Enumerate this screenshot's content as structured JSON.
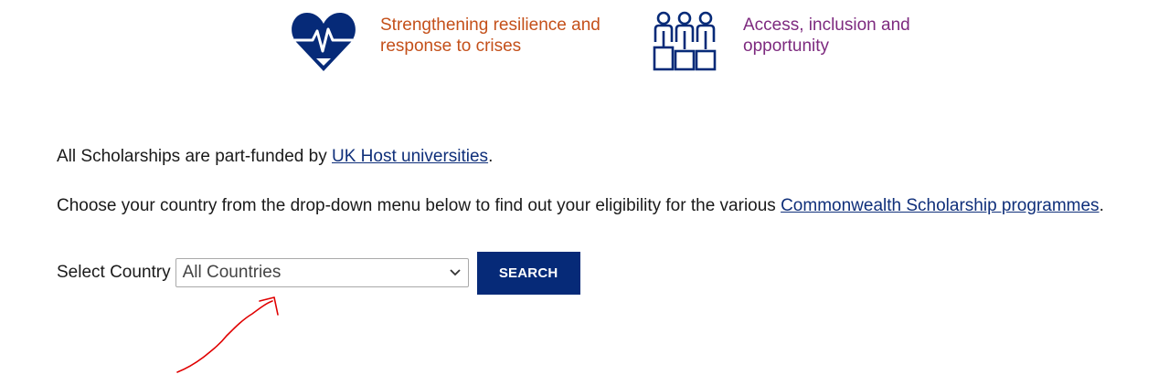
{
  "themes": [
    {
      "icon": "heart-pulse-icon",
      "label": "Strengthening resilience and response to crises",
      "color": "#c4501a"
    },
    {
      "icon": "people-group-icon",
      "label": "Access, inclusion and opportunity",
      "color": "#7d2a7f"
    }
  ],
  "funding_text": {
    "before": "All Scholarships are part-funded by ",
    "link": "UK Host universities",
    "after": "."
  },
  "eligibility_text": {
    "before": "Choose your country from the drop-down menu below to find out your eligibility for the various ",
    "link": "Commonwealth Scholarship programmes",
    "after": "."
  },
  "country_select": {
    "label": "Select Country",
    "selected": "All Countries"
  },
  "search_button": "SEARCH",
  "colors": {
    "brand_blue": "#062a78",
    "link": "#0f2f7a",
    "annotation_red": "#e00000"
  }
}
